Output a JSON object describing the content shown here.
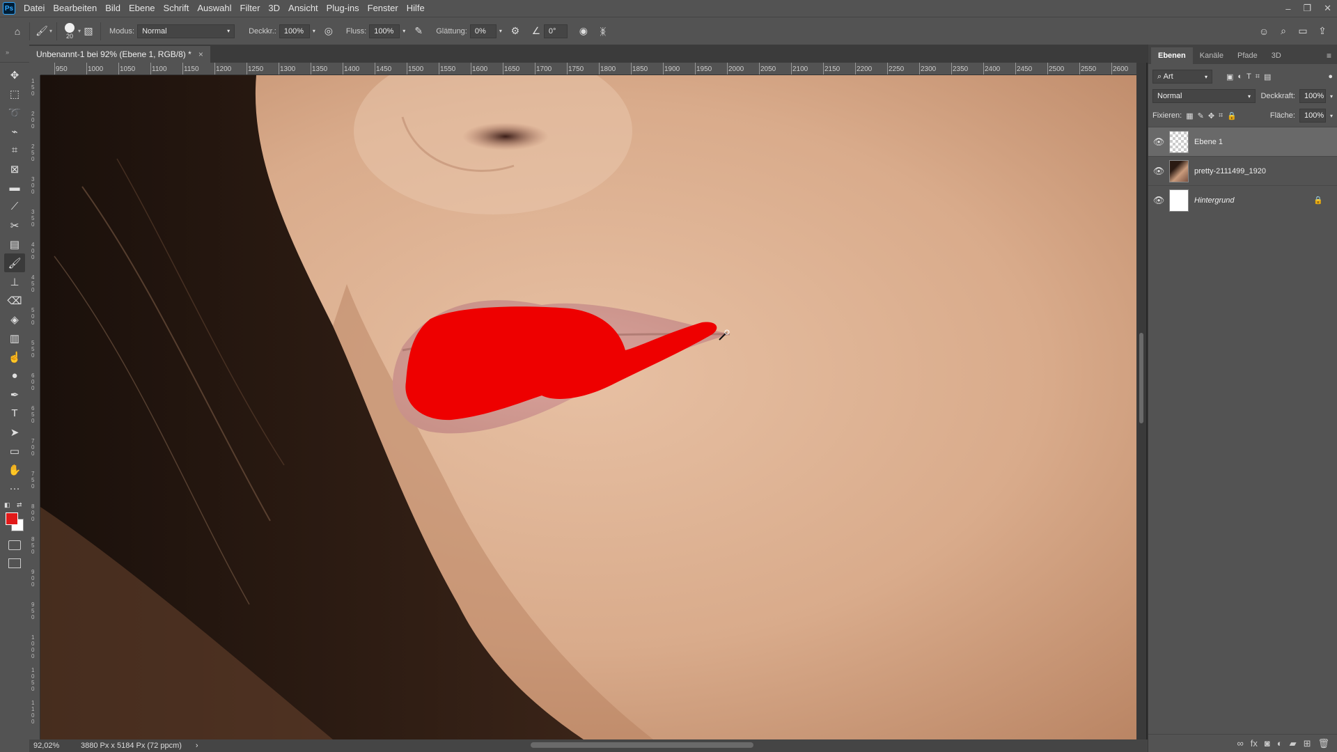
{
  "app": {
    "logo": "Ps"
  },
  "menu": [
    "Datei",
    "Bearbeiten",
    "Bild",
    "Ebene",
    "Schrift",
    "Auswahl",
    "Filter",
    "3D",
    "Ansicht",
    "Plug-ins",
    "Fenster",
    "Hilfe"
  ],
  "window_controls": [
    "–",
    "❐",
    "✕"
  ],
  "options_bar": {
    "brush_size": "20",
    "modus_label": "Modus:",
    "modus_value": "Normal",
    "deckkraft_label": "Deckkr.:",
    "deckkraft_value": "100%",
    "fluss_label": "Fluss:",
    "fluss_value": "100%",
    "glaettung_label": "Glättung:",
    "glaettung_value": "0%",
    "angle_value": "0°"
  },
  "document_tab": {
    "title": "Unbenannt-1 bei 92% (Ebene 1, RGB/8) *",
    "close": "×"
  },
  "ruler": {
    "h_ticks": [
      "950",
      "1000",
      "1050",
      "1100",
      "1150",
      "1200",
      "1250",
      "1300",
      "1350",
      "1400",
      "1450",
      "1500",
      "1550",
      "1600",
      "1650",
      "1700",
      "1750",
      "1800",
      "1850",
      "1900",
      "1950",
      "2000",
      "2050",
      "2100",
      "2150",
      "2200",
      "2250",
      "2300",
      "2350",
      "2400",
      "2450",
      "2500",
      "2550",
      "2600"
    ],
    "v_labels": [
      "150",
      "200",
      "250",
      "300",
      "350",
      "400",
      "450",
      "500",
      "550",
      "600",
      "650",
      "700",
      "750",
      "800",
      "850",
      "900",
      "950",
      "1000",
      "1050",
      "1100"
    ]
  },
  "status": {
    "zoom": "92,02%",
    "doc_info": "3880 Px x 5184 Px (72 ppcm)"
  },
  "colors": {
    "foreground": "#e21a1a",
    "background": "#ffffff",
    "paint": "#ee0000"
  },
  "layers_panel": {
    "tabs": [
      "Ebenen",
      "Kanäle",
      "Pfade",
      "3D"
    ],
    "filter_label": "Art",
    "blend_mode": "Normal",
    "opacity_label": "Deckkraft:",
    "opacity_value": "100%",
    "lock_label": "Fixieren:",
    "fill_label": "Fläche:",
    "fill_value": "100%",
    "layers": [
      {
        "name": "Ebene 1",
        "selected": true
      },
      {
        "name": "pretty-2111499_1920",
        "selected": false
      },
      {
        "name": "Hintergrund",
        "selected": false,
        "locked": true
      }
    ]
  }
}
